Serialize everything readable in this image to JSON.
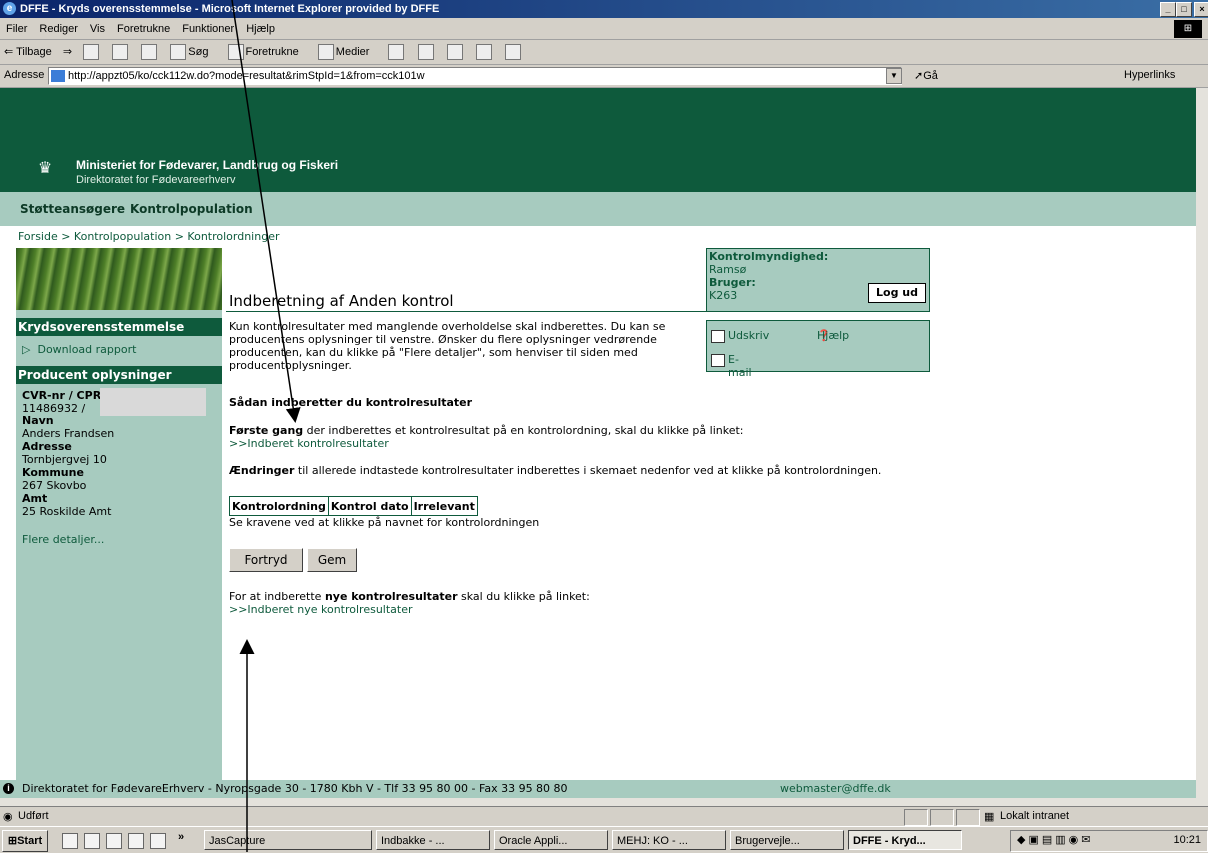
{
  "window": {
    "title": "DFFE - Kryds overensstemmelse - Microsoft Internet Explorer provided by DFFE",
    "min": "_",
    "max": "□",
    "close": "×"
  },
  "menu": [
    "Filer",
    "Rediger",
    "Vis",
    "Foretrukne",
    "Funktioner",
    "Hjælp"
  ],
  "toolbar": {
    "back": "⇐ Tilbage",
    "forward": "⇒",
    "search": "Søg",
    "favorites": "Foretrukne",
    "media": "Medier"
  },
  "address": {
    "label": "Adresse",
    "url": "http://appzt05/ko/cck112w.do?mode=resultat&rimStpId=1&from=cck101w",
    "go": "Gå",
    "links": "Hyperlinks"
  },
  "banner": {
    "line1": "Ministeriet for Fødevarer, Landbrug og Fiskeri",
    "line2": "Direktoratet for Fødevareerhverv"
  },
  "nav": [
    "Støtteansøgere",
    "Kontrolpopulation"
  ],
  "breadcrumb": "Forside > Kontrolpopulation > Kontrolordninger",
  "sidebar": {
    "section1": "Krydsoverensstemmelse",
    "download": "Download rapport",
    "section2": "Producent oplysninger",
    "cvr_label": "CVR-nr / CPR-nr :",
    "cvr_value": "11486932 /",
    "name_label": "Navn",
    "name_value": "Anders Frandsen",
    "address_label": "Adresse",
    "address_value": "Tornbjergvej 10",
    "kommune_label": "Kommune",
    "kommune_value": "267 Skovbo",
    "amt_label": "Amt",
    "amt_value": "25 Roskilde Amt",
    "more": "Flere detaljer..."
  },
  "main": {
    "heading": "Indberetning af Anden kontrol",
    "intro": "Kun kontrolresultater med manglende overholdelse skal indberettes. Du kan se producentens oplysninger til venstre. Ønsker du flere oplysninger vedrørende producenten, kan du klikke på \"Flere detaljer\", som henviser til siden med producentoplysninger.",
    "howto_heading": "Sådan indberetter du kontrolresultater",
    "first_bold": "Første gang",
    "first_rest": " der indberettes et kontrolresultat på en kontrolordning, skal du klikke på linket:",
    "first_link": ">>Indberet kontrolresultater",
    "changes_bold": "Ændringer",
    "changes_rest": " til allerede indtastede kontrolresultater indberettes i skemaet nedenfor ved at klikke på kontrolordningen.",
    "table_headers": [
      "Kontrolordning",
      "Kontrol dato",
      "Irrelevant"
    ],
    "table_note": "Se kravene ved at klikke på navnet for kontrolordningen",
    "btn_cancel": "Fortryd",
    "btn_save": "Gem",
    "new_pre": "For at indberette ",
    "new_bold": "nye kontrolresultater",
    "new_post": " skal du klikke på linket:",
    "new_link": ">>Indberet nye kontrolresultater"
  },
  "infobox": {
    "authority_label": "Kontrolmyndighed:",
    "authority_value": "Ramsø",
    "user_label": "Bruger:",
    "user_value": "K263",
    "logout": "Log ud"
  },
  "tools": {
    "print": "Udskriv",
    "help": "Hjælp",
    "email": "E-mail"
  },
  "footer": {
    "text": "Direktoratet for FødevareErhverv - Nyropsgade 30 - 1780 Kbh V - Tlf 33 95 80 00 - Fax 33 95 80 80",
    "email": "webmaster@dffe.dk"
  },
  "statusbar": {
    "done": "Udført",
    "zone": "Lokalt intranet"
  },
  "taskbar": {
    "start": "Start",
    "more": "»",
    "tasks": [
      "JasCapture",
      "Indbakke - ...",
      "Oracle Appli...",
      "MEHJ: KO - ...",
      "Brugervejle...",
      "DFFE - Kryd..."
    ],
    "clock": "10:21"
  }
}
